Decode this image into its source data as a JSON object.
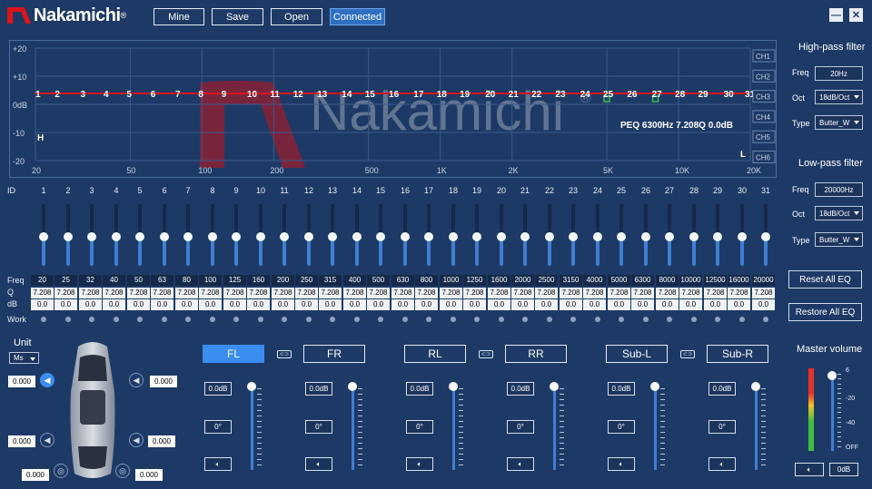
{
  "app": {
    "logo_text": "Nakamichi"
  },
  "toolbar": {
    "mine": "Mine",
    "save": "Save",
    "open": "Open",
    "connected": "Connected"
  },
  "window": {
    "minimize": "—",
    "close": "✕"
  },
  "graph": {
    "y_labels": [
      "+20",
      "+10",
      "0dB",
      "-10",
      "-20"
    ],
    "x_labels": [
      "20",
      "50",
      "100",
      "200",
      "500",
      "1K",
      "2K",
      "5K",
      "10K",
      "20K"
    ],
    "channels": [
      "CH1",
      "CH2",
      "CH3",
      "CH4",
      "CH5",
      "CH6"
    ],
    "point_labels": [
      "1",
      "2",
      "3",
      "4",
      "5",
      "6",
      "7",
      "8",
      "9",
      "10",
      "11",
      "12",
      "13",
      "14",
      "15",
      "16",
      "17",
      "18",
      "19",
      "20",
      "21",
      "22",
      "23",
      "24",
      "25",
      "26",
      "27",
      "28",
      "29",
      "30",
      "31"
    ],
    "info": "PEQ 6300Hz 7.208Q 0.0dB",
    "hp_marker": "H",
    "lp_marker": "L",
    "watermark": "Nakamichi",
    "watermark_mark": "®",
    "curve_color": "#d8151b"
  },
  "high_pass": {
    "title": "High-pass filter",
    "freq_label": "Freq",
    "freq": "20Hz",
    "oct_label": "Oct",
    "oct": "18dB/Oct",
    "type_label": "Type",
    "type": "Butter_W"
  },
  "low_pass": {
    "title": "Low-pass filter",
    "freq_label": "Freq",
    "freq": "20000Hz",
    "oct_label": "Oct",
    "oct": "18dB/Oct",
    "type_label": "Type",
    "type": "Butter_W"
  },
  "actions": {
    "reset": "Reset All EQ",
    "restore": "Restore All EQ"
  },
  "eq": {
    "id_label": "ID",
    "freq_label": "Freq",
    "q_label": "Q",
    "db_label": "dB",
    "work_label": "Work",
    "ids": [
      "1",
      "2",
      "3",
      "4",
      "5",
      "6",
      "7",
      "8",
      "9",
      "10",
      "11",
      "12",
      "13",
      "14",
      "15",
      "16",
      "17",
      "18",
      "19",
      "20",
      "21",
      "22",
      "23",
      "24",
      "25",
      "26",
      "27",
      "28",
      "29",
      "30",
      "31"
    ],
    "freqs": [
      "20",
      "25",
      "32",
      "40",
      "50",
      "63",
      "80",
      "100",
      "125",
      "160",
      "200",
      "250",
      "315",
      "400",
      "500",
      "630",
      "800",
      "1000",
      "1250",
      "1600",
      "2000",
      "2500",
      "3150",
      "4000",
      "5000",
      "6300",
      "8000",
      "10000",
      "12500",
      "16000",
      "20000"
    ],
    "q": [
      "7.208",
      "7.208",
      "7.208",
      "7.208",
      "7.208",
      "7.208",
      "7.208",
      "7.208",
      "7.208",
      "7.208",
      "7.208",
      "7.208",
      "7.208",
      "7.208",
      "7.208",
      "7.208",
      "7.208",
      "7.208",
      "7.208",
      "7.208",
      "7.208",
      "7.208",
      "7.208",
      "7.208",
      "7.208",
      "7.208",
      "7.208",
      "7.208",
      "7.208",
      "7.208",
      "7.208"
    ],
    "db": [
      "0.0",
      "0.0",
      "0.0",
      "0.0",
      "0.0",
      "0.0",
      "0.0",
      "0.0",
      "0.0",
      "0.0",
      "0.0",
      "0.0",
      "0.0",
      "0.0",
      "0.0",
      "0.0",
      "0.0",
      "0.0",
      "0.0",
      "0.0",
      "0.0",
      "0.0",
      "0.0",
      "0.0",
      "0.0",
      "0.0",
      "0.0",
      "0.0",
      "0.0",
      "0.0",
      "0.0"
    ]
  },
  "unit": {
    "label": "Unit",
    "value": "Ms",
    "values": [
      "0.000",
      "0.000",
      "0.000",
      "0.000",
      "0.000",
      "0.000"
    ]
  },
  "channels": [
    {
      "name": "FL",
      "gain": "0.0dB",
      "phase": "0°"
    },
    {
      "name": "FR",
      "gain": "0.0dB",
      "phase": "0°"
    },
    {
      "name": "RL",
      "gain": "0.0dB",
      "phase": "0°"
    },
    {
      "name": "RR",
      "gain": "0.0dB",
      "phase": "0°"
    },
    {
      "name": "Sub-L",
      "gain": "0.0dB",
      "phase": "0°"
    },
    {
      "name": "Sub-R",
      "gain": "0.0dB",
      "phase": "0°"
    }
  ],
  "master": {
    "title": "Master volume",
    "scale": [
      "6",
      "-20",
      "-40",
      "OFF"
    ],
    "value": "0dB"
  }
}
